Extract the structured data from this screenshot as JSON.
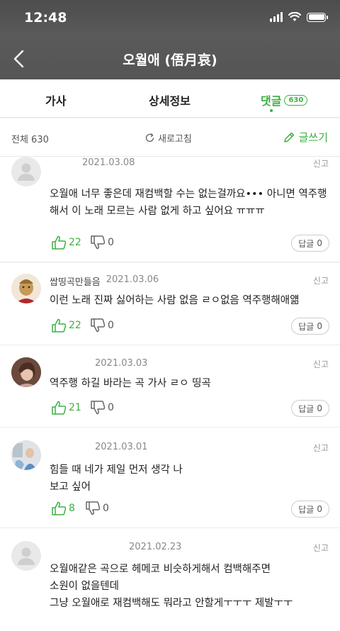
{
  "status_bar": {
    "time": "12:48"
  },
  "header": {
    "title": "오월애 (俉月哀)"
  },
  "tabs": [
    {
      "label": "가사"
    },
    {
      "label": "상세정보"
    },
    {
      "label": "댓글",
      "count": "630"
    }
  ],
  "toolbar": {
    "total_label": "전체 630",
    "refresh_label": "새로고침",
    "write_label": "글쓰기"
  },
  "accent_color": "#3cb043",
  "comments": [
    {
      "author": "",
      "date": "2021.03.08",
      "report": "신고",
      "text": "오월애 너무 좋은데 재컴백할 수는 없는걸까요••• 아니면 역주행해서 이 노래 모르는 사람 없게 하고 싶어요 ㅠㅠㅠ",
      "likes": "22",
      "dislikes": "0",
      "reply_label": "답글",
      "reply_count": "0",
      "avatar": "default-avatar"
    },
    {
      "author": "쌉띵곡만들음",
      "date": "2021.03.06",
      "report": "신고",
      "text": "이런 노래 진짜 싫어하는 사람 없음 ㄹㅇ없음 역주행해애얢",
      "likes": "22",
      "dislikes": "0",
      "reply_label": "답글",
      "reply_count": "0",
      "avatar": "character-avatar"
    },
    {
      "author": "",
      "date": "2021.03.03",
      "report": "신고",
      "text": "역주행 하길 바라는 곡 가사 ㄹㅇ 띵곡",
      "likes": "21",
      "dislikes": "0",
      "reply_label": "답글",
      "reply_count": "0",
      "avatar": "photo-avatar"
    },
    {
      "author": "",
      "date": "2021.03.01",
      "report": "신고",
      "text": "힘들 때 네가 제일 먼저 생각 나\n보고 싶어",
      "likes": "8",
      "dislikes": "0",
      "reply_label": "답글",
      "reply_count": "0",
      "avatar": "photo-avatar-2"
    },
    {
      "author": "",
      "date": "2021.02.23",
      "report": "신고",
      "text": "오월애같은 곡으로 헤메코 비슷하게해서 컴백해주면\n소원이 없을텐데\n그냥 오월애로 재컴백해도 뭐라고 안할게ㅜㅜㅜ 제발ㅜㅜ",
      "likes": "",
      "dislikes": "",
      "reply_label": "",
      "reply_count": "",
      "avatar": "default-avatar"
    }
  ]
}
